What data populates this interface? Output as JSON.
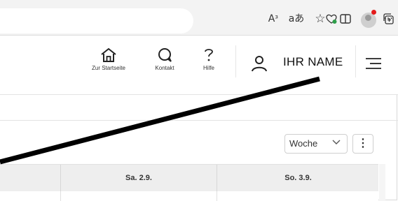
{
  "browser": {
    "icons": [
      "read-aloud-icon",
      "translate-icon",
      "favorite-star-icon",
      "split-screen-icon",
      "favorites-list-icon",
      "collections-icon",
      "browser-essentials-icon",
      "profile-icon",
      "more-icon"
    ],
    "read_aloud_glyph": "Aᶟ",
    "translate_glyph": "aあ",
    "more_glyph": "···",
    "profile_notification_color": "#e41b1b"
  },
  "header": {
    "nav": [
      {
        "label": "Zur Startseite",
        "icon": "home-icon"
      },
      {
        "label": "Kontakt",
        "icon": "chat-icon"
      },
      {
        "label": "Hilfe",
        "icon": "question-icon"
      }
    ],
    "user_name": "IHR NAME",
    "user_icon": "user-icon",
    "menu_icon": "hamburger-menu-icon"
  },
  "calendar": {
    "view_select": "Woche",
    "more_label": "⋮",
    "columns": [
      "Sa. 2.9.",
      "So. 3.9."
    ]
  },
  "annotation": {
    "color": "#000000"
  }
}
